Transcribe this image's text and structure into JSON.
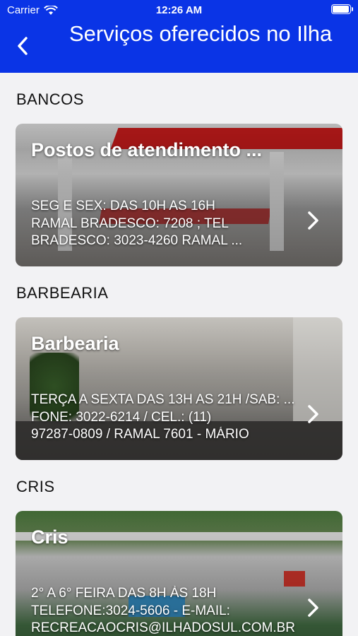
{
  "status_bar": {
    "carrier": "Carrier",
    "time": "12:26 AM",
    "battery_level": 1.0
  },
  "header": {
    "title": "Serviços oferecidos no Ilha",
    "back_icon": "chevron-left-icon",
    "background_color": "#0a34e6"
  },
  "sections": [
    {
      "heading": "BANCOS",
      "card": {
        "title": "Postos de atendimento ...",
        "lines": [
          "SEG E SEX: DAS 10H AS 16H",
          "RAMAL BRADESCO: 7208 ; TEL",
          "BRADESCO: 3023-4260 RAMAL ..."
        ],
        "chevron_icon": "chevron-right-icon"
      }
    },
    {
      "heading": "BARBEARIA",
      "card": {
        "title": "Barbearia",
        "lines": [
          "TERÇA A SEXTA DAS 13H AS 21H /SAB: ...",
          "FONE: 3022-6214 / CEL.: (11)",
          "97287-0809 / RAMAL 7601 - MÁRIO"
        ],
        "chevron_icon": "chevron-right-icon"
      }
    },
    {
      "heading": "CRIS",
      "card": {
        "title": "Cris",
        "lines": [
          "2° A 6° FEIRA DAS 8H ÀS 18H",
          "TELEFONE:3024-5606 - E-MAIL:",
          "RECREACAOCRIS@ILHADOSUL.COM.BR"
        ],
        "chevron_icon": "chevron-right-icon"
      }
    }
  ]
}
